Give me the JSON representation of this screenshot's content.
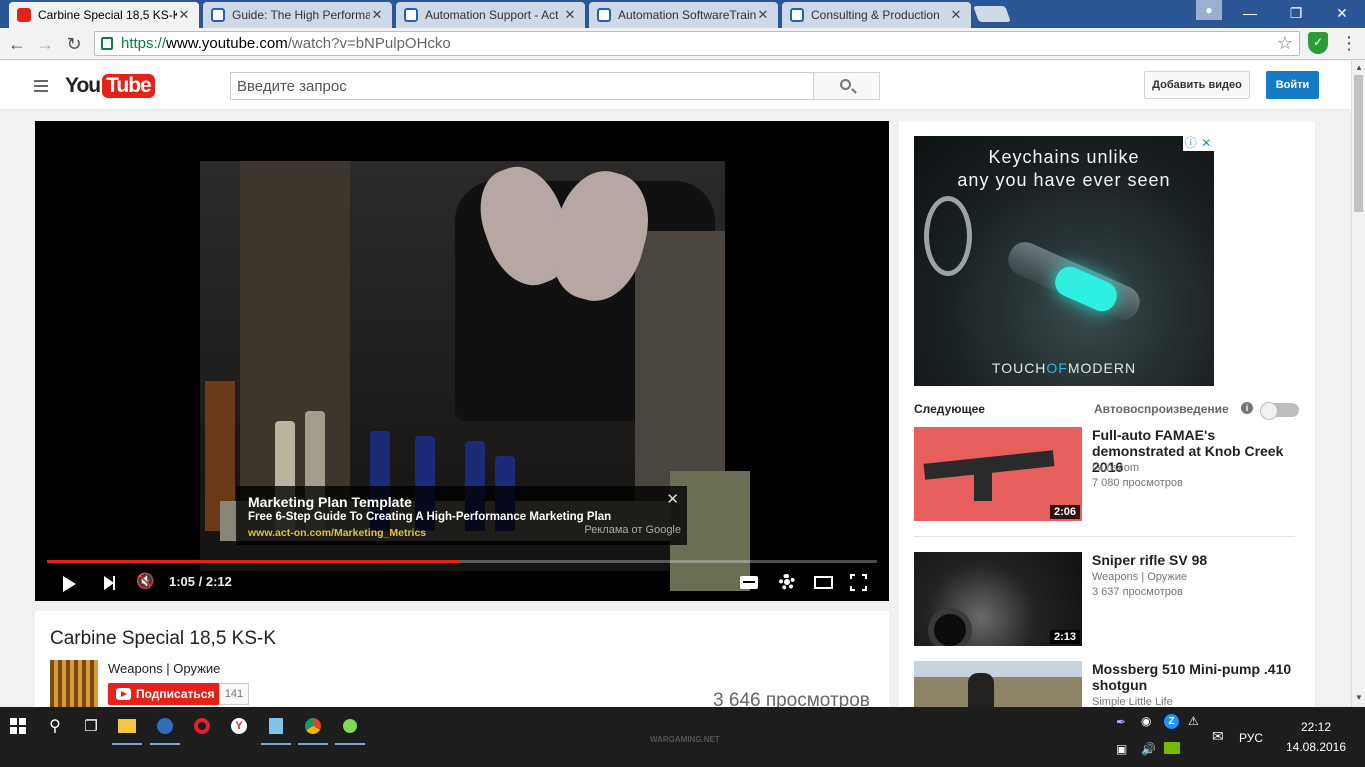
{
  "browser": {
    "tabs": [
      {
        "title": "Carbine Special 18,5 KS-K",
        "icon": "youtube-favicon",
        "active": true
      },
      {
        "title": "Guide: The High Performa",
        "icon": "power-favicon",
        "active": false
      },
      {
        "title": "Automation Support - Act",
        "icon": "power-favicon",
        "active": false
      },
      {
        "title": "Automation SoftwareTrain",
        "icon": "power-favicon",
        "active": false
      },
      {
        "title": "Consulting & Production",
        "icon": "power-favicon",
        "active": false
      }
    ],
    "url_scheme": "https://",
    "url_host": "www.youtube.com",
    "url_path": "/watch?v=bNPulpOHcko"
  },
  "header": {
    "logo_you": "You",
    "logo_tube": "Tube",
    "search_placeholder": "Введите запрос",
    "upload_label": "Добавить видео",
    "signin_label": "Войти"
  },
  "player": {
    "ad_title": "Marketing Plan Template",
    "ad_line": "Free 6-Step Guide To Creating A High-Performance Marketing Plan",
    "ad_url": "www.act-on.com/Marketing_Metrics",
    "ad_by": "Реклама от Google",
    "time": "1:05 / 2:12",
    "progress_fraction": 0.496,
    "accent": "#e62117"
  },
  "video": {
    "title": "Carbine Special 18,5 KS-K",
    "channel": "Weapons | Оружие",
    "subscribe_label": "Подписаться",
    "subscriber_count": "141",
    "views": "3 646 просмотров"
  },
  "sidebar": {
    "ad_text_line1": "Keychains unlike",
    "ad_text_line2": "any you have ever seen",
    "ad_brand_a": "TOUCH",
    "ad_brand_b": "OF",
    "ad_brand_c": "MODERN",
    "next_label": "Следующее",
    "autoplay_label": "Автовоспроизведение",
    "related": [
      {
        "title": "Full-auto FAMAE's demonstrated at Knob Creek 2016",
        "channel": "Gunscom",
        "views": "7 080 просмотров",
        "duration": "2:06"
      },
      {
        "title": "Sniper rifle SV 98",
        "channel": "Weapons | Оружие",
        "views": "3 637 просмотров",
        "duration": "2:13"
      },
      {
        "title": "Mossberg 510 Mini-pump .410 shotgun",
        "channel": "Simple Little Life",
        "views": "",
        "duration": ""
      }
    ]
  },
  "taskbar": {
    "watermark": "WARGAMING.NET",
    "lang": "РУС",
    "time": "22:12",
    "date": "14.08.2016"
  }
}
